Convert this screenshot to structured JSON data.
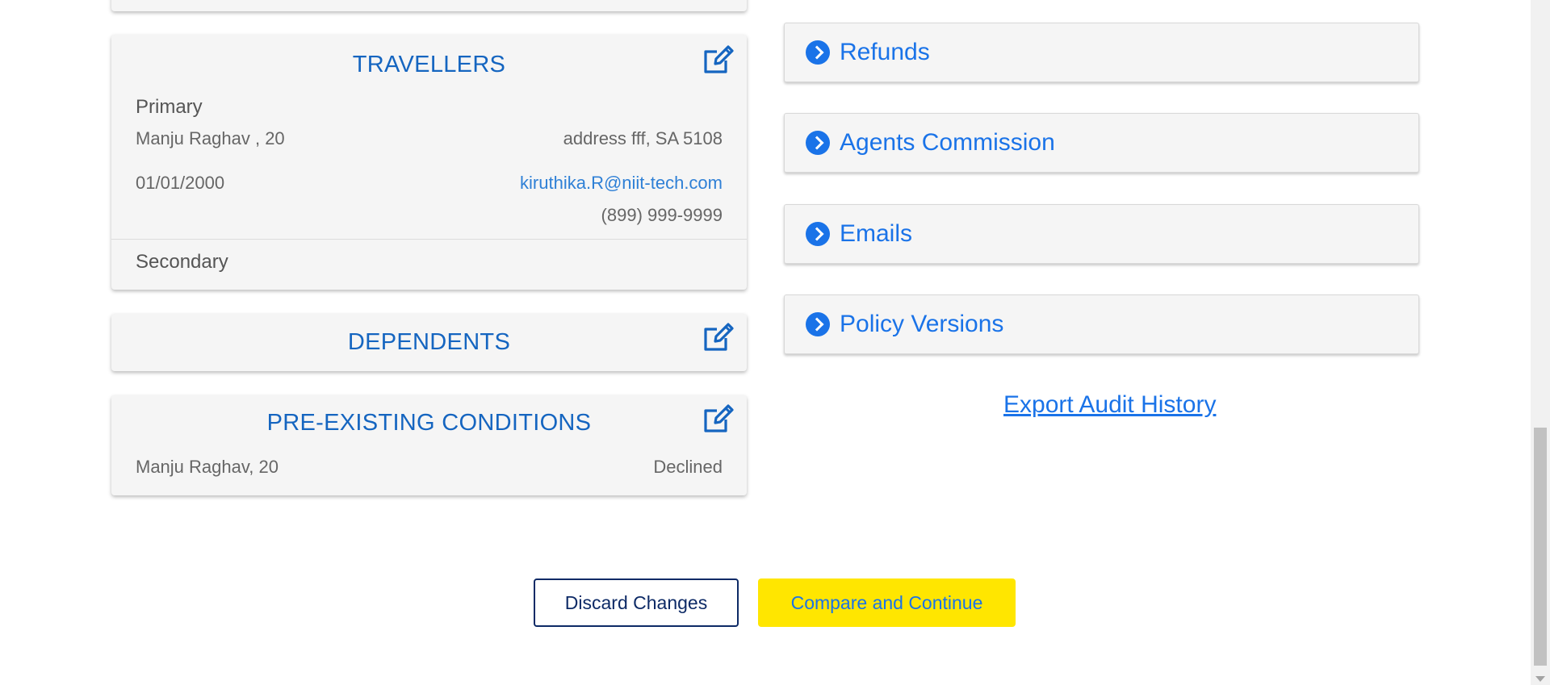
{
  "travellers": {
    "title": "TRAVELLERS",
    "primary_label": "Primary",
    "primary_name_age": "Manju Raghav , 20",
    "primary_address": "address fff, SA 5108",
    "primary_dob": "01/01/2000",
    "primary_email": "kiruthika.R@niit-tech.com",
    "primary_phone": "(899) 999-9999",
    "secondary_label": "Secondary"
  },
  "dependents": {
    "title": "DEPENDENTS"
  },
  "pre_existing": {
    "title": "PRE-EXISTING CONDITIONS",
    "name_age": "Manju Raghav, 20",
    "status": "Declined"
  },
  "accordions": [
    {
      "label": "Refunds"
    },
    {
      "label": "Agents Commission"
    },
    {
      "label": "Emails"
    },
    {
      "label": "Policy Versions"
    }
  ],
  "export_link": "Export Audit History",
  "buttons": {
    "discard": "Discard Changes",
    "continue": "Compare and Continue"
  },
  "colors": {
    "accent_blue": "#1a73e8",
    "heading_blue": "#1565c0",
    "continue_yellow": "#ffe600",
    "discard_border": "#0d2a66"
  }
}
